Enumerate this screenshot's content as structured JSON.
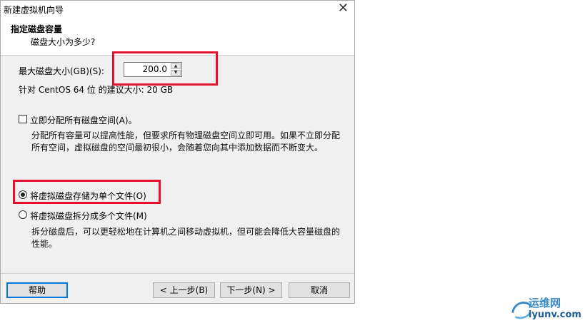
{
  "window": {
    "title": "新建虚拟机向导",
    "close_symbol": "✕"
  },
  "header": {
    "title": "指定磁盘容量",
    "subtitle": "磁盘大小为多少?"
  },
  "disk_size": {
    "label": "最大磁盘大小(GB)(S):",
    "value": "200.0"
  },
  "recommend": {
    "text": "针对 CentOS 64 位 的建议大小: 20 GB"
  },
  "allocate": {
    "label": "立即分配所有磁盘空间(A)。",
    "checked": false,
    "desc_line1": "分配所有容量可以提高性能，但要求所有物理磁盘空间立即可用。如果不立即分配",
    "desc_line2": "所有空间，虚拟磁盘的空间最初很小，会随着您向其中添加数据而不断变大。"
  },
  "storage": {
    "single_label": "将虚拟磁盘存储为单个文件(O)",
    "single_selected": true,
    "split_label": "将虚拟磁盘拆分成多个文件(M)",
    "split_desc_line1": "拆分磁盘后，可以更轻松地在计算机之间移动虚拟机，但可能会降低大容量磁盘的",
    "split_desc_line2": "性能。"
  },
  "buttons": {
    "help": "帮助",
    "back": "< 上一步(B)",
    "next": "下一步(N) >",
    "cancel": "取消"
  },
  "watermark": {
    "cn": "运维网",
    "en": "iyunv.com"
  },
  "colors": {
    "highlight": "#e8112d",
    "accent": "#0078d7"
  }
}
